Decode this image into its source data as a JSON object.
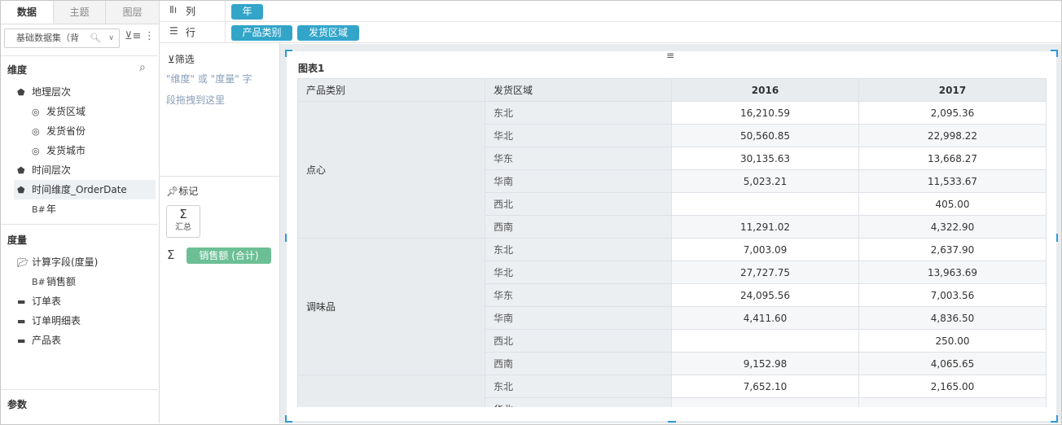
{
  "left_panel": {
    "tabs": [
      "数据",
      "主题",
      "图层"
    ],
    "dataset": "基础数据集（背",
    "dimension_title": "维度",
    "measure_title": "度量",
    "param_title": "参数",
    "dimensions": [
      {
        "label": "地理层次",
        "icon": "layers-icon"
      },
      {
        "label": "发货区域",
        "icon": "globe-icon"
      },
      {
        "label": "发货省份",
        "icon": "globe-icon"
      },
      {
        "label": "发货城市",
        "icon": "globe-icon"
      },
      {
        "label": "时间层次",
        "icon": "layers-icon"
      },
      {
        "label": "时间维度_OrderDate",
        "icon": "layers-icon"
      },
      {
        "label": "年",
        "icon": "field-icon"
      }
    ],
    "measures": [
      {
        "label": "计算字段(度量)",
        "icon": "folder-open-icon"
      },
      {
        "label": "销售额",
        "icon": "field-icon"
      },
      {
        "label": "订单表",
        "icon": "folder-icon"
      },
      {
        "label": "订单明细表",
        "icon": "folder-icon"
      },
      {
        "label": "产品表",
        "icon": "folder-icon"
      }
    ]
  },
  "shelves": {
    "column_label": "列",
    "row_label": "行",
    "column_pills": [
      "年"
    ],
    "row_pills": [
      "产品类别",
      "发货区域"
    ]
  },
  "middle_panel": {
    "filter_title": "筛选",
    "filter_hint_1": "\"维度\" 或 \"度量\" 字",
    "filter_hint_2": "段拖拽到这里",
    "mark_title": "标记",
    "summary_label": "汇总",
    "measure_pill": "销售额 (合计)"
  },
  "chart": {
    "title": "图表1",
    "headers": [
      "产品类别",
      "发货区域",
      "2016",
      "2017"
    ],
    "groups": [
      {
        "category": "点心",
        "rows": [
          {
            "region": "东北",
            "v2016": "16,210.59",
            "v2017": "2,095.36"
          },
          {
            "region": "华北",
            "v2016": "50,560.85",
            "v2017": "22,998.22"
          },
          {
            "region": "华东",
            "v2016": "30,135.63",
            "v2017": "13,668.27"
          },
          {
            "region": "华南",
            "v2016": "5,023.21",
            "v2017": "11,533.67"
          },
          {
            "region": "西北",
            "v2016": "",
            "v2017": "405.00"
          },
          {
            "region": "西南",
            "v2016": "11,291.02",
            "v2017": "4,322.90"
          }
        ]
      },
      {
        "category": "调味品",
        "rows": [
          {
            "region": "东北",
            "v2016": "7,003.09",
            "v2017": "2,637.90"
          },
          {
            "region": "华北",
            "v2016": "27,727.75",
            "v2017": "13,963.69"
          },
          {
            "region": "华东",
            "v2016": "24,095.56",
            "v2017": "7,003.56"
          },
          {
            "region": "华南",
            "v2016": "4,411.60",
            "v2017": "4,836.50"
          },
          {
            "region": "西北",
            "v2016": "",
            "v2017": "250.00"
          },
          {
            "region": "西南",
            "v2016": "9,152.98",
            "v2017": "4,065.65"
          }
        ]
      },
      {
        "category": "",
        "rows": [
          {
            "region": "东北",
            "v2016": "7,652.10",
            "v2017": "2,165.00"
          },
          {
            "region": "华北",
            "v2016": "",
            "v2017": ""
          }
        ]
      }
    ]
  },
  "colors": {
    "accent_blue": "#33a5c9",
    "measure_green": "#6cbf95",
    "selection_blue": "#2f9ad6"
  }
}
